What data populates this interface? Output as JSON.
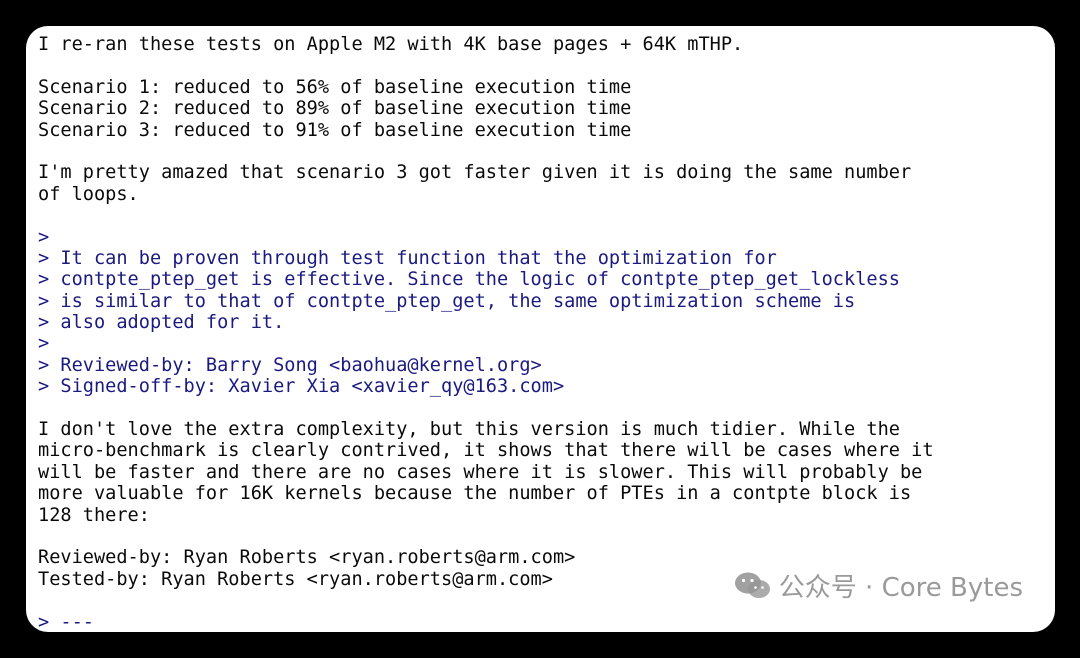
{
  "email": {
    "lines": [
      {
        "text": "I re-ran these tests on Apple M2 with 4K base pages + 64K mTHP.",
        "quoted": false
      },
      {
        "text": "",
        "quoted": false
      },
      {
        "text": "Scenario 1: reduced to 56% of baseline execution time",
        "quoted": false
      },
      {
        "text": "Scenario 2: reduced to 89% of baseline execution time",
        "quoted": false
      },
      {
        "text": "Scenario 3: reduced to 91% of baseline execution time",
        "quoted": false
      },
      {
        "text": "",
        "quoted": false
      },
      {
        "text": "I'm pretty amazed that scenario 3 got faster given it is doing the same number",
        "quoted": false
      },
      {
        "text": "of loops.",
        "quoted": false
      },
      {
        "text": "",
        "quoted": false
      },
      {
        "text": ">",
        "quoted": true
      },
      {
        "text": "> It can be proven through test function that the optimization for",
        "quoted": true
      },
      {
        "text": "> contpte_ptep_get is effective. Since the logic of contpte_ptep_get_lockless",
        "quoted": true
      },
      {
        "text": "> is similar to that of contpte_ptep_get, the same optimization scheme is",
        "quoted": true
      },
      {
        "text": "> also adopted for it.",
        "quoted": true
      },
      {
        "text": ">",
        "quoted": true
      },
      {
        "text": "> Reviewed-by: Barry Song <baohua@kernel.org>",
        "quoted": true
      },
      {
        "text": "> Signed-off-by: Xavier Xia <xavier_qy@163.com>",
        "quoted": true
      },
      {
        "text": "",
        "quoted": false
      },
      {
        "text": "I don't love the extra complexity, but this version is much tidier. While the",
        "quoted": false
      },
      {
        "text": "micro-benchmark is clearly contrived, it shows that there will be cases where it",
        "quoted": false
      },
      {
        "text": "will be faster and there are no cases where it is slower. This will probably be",
        "quoted": false
      },
      {
        "text": "more valuable for 16K kernels because the number of PTEs in a contpte block is",
        "quoted": false
      },
      {
        "text": "128 there:",
        "quoted": false
      },
      {
        "text": "",
        "quoted": false
      },
      {
        "text": "Reviewed-by: Ryan Roberts <ryan.roberts@arm.com>",
        "quoted": false
      },
      {
        "text": "Tested-by: Ryan Roberts <ryan.roberts@arm.com>",
        "quoted": false
      },
      {
        "text": "",
        "quoted": false
      },
      {
        "text": "> ---",
        "quoted": true
      }
    ]
  },
  "watermark": {
    "text": "公众号 · Core Bytes",
    "icon": "wechat-icon"
  },
  "colors": {
    "background": "#000000",
    "card": "#ffffff",
    "text": "#0a0a0a",
    "quote": "#1a1a80"
  }
}
